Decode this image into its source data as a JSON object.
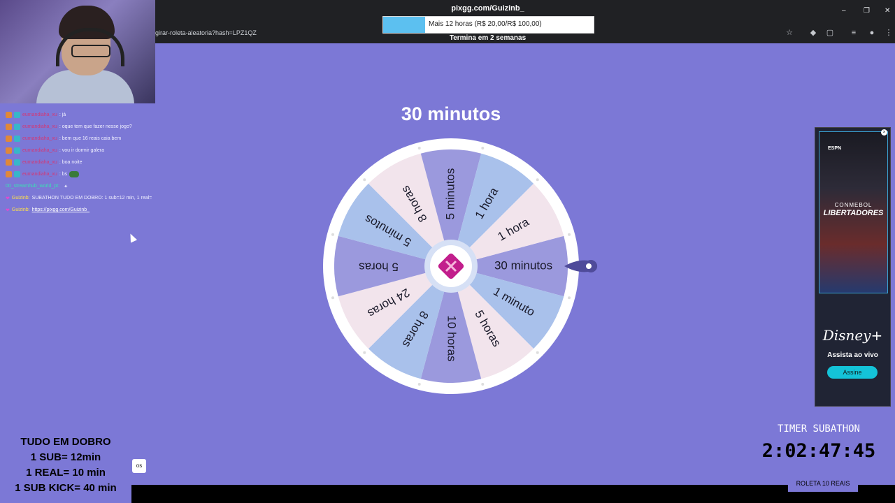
{
  "browser": {
    "url": "girar-roleta-aleatoria?hash=LPZ1QZ",
    "window_controls": [
      "–",
      "❐",
      "✕"
    ]
  },
  "goal": {
    "title": "pixgg.com/Guizinb_",
    "progress_text": "Mais 12 horas (R$ 20,00/R$ 100,00)",
    "progress_fraction": 0.2,
    "ends_text": "Termina em 2 semanas"
  },
  "wheel": {
    "result": "30 minutos",
    "segments": [
      "30 minutos",
      "1 minuto",
      "5 horas",
      "10 horas",
      "8 horas",
      "24 horas",
      "5 horas",
      "5 minutos",
      "8 horas",
      "5 minutos",
      "1 hora",
      "1 hora"
    ],
    "colors": [
      "#9b99dd",
      "#a9c1eb",
      "#f2e4ec"
    ]
  },
  "chat": {
    "messages": [
      {
        "user": "eumandiaha_xu",
        "text": ": já"
      },
      {
        "user": "eumandiaha_xu",
        "text": ": oque tem que fazer nesse jogo?"
      },
      {
        "user": "eumandiaha_xu",
        "text": ": bem que 16 reais caia bem"
      },
      {
        "user": "eumandiaha_xu",
        "text": ": vou ir dormir galera"
      },
      {
        "user": "eumandiaha_xu",
        "text": ": boa noite"
      },
      {
        "user": "eumandiaha_xu",
        "text": ": bs"
      },
      {
        "user": "00_streamhub_world_pt:",
        "text": ""
      },
      {
        "user": "Guizinb:",
        "text": "SUBATHON TUDO EM DOBRO: 1 sub=12 min, 1 real="
      },
      {
        "user": "Guizinb:",
        "text": "https://pixgg.com/Guizinb_"
      }
    ]
  },
  "ad": {
    "brand": "ESPN",
    "league_top": "CONMEBOL",
    "league": "LIBERTADORES",
    "streamer": "Disney+",
    "tagline": "Assista ao vivo",
    "cta": "Assine"
  },
  "promo": {
    "lines": [
      "TUDO EM DOBRO",
      "1 SUB= 12min",
      "1 REAL= 10 min",
      "1 SUB KICK= 40 min"
    ]
  },
  "small_button": "os",
  "timer": {
    "title": "TIMER SUBATHON",
    "value": "2:02:47:45",
    "roleta": "ROLETA 10 REAIS"
  }
}
